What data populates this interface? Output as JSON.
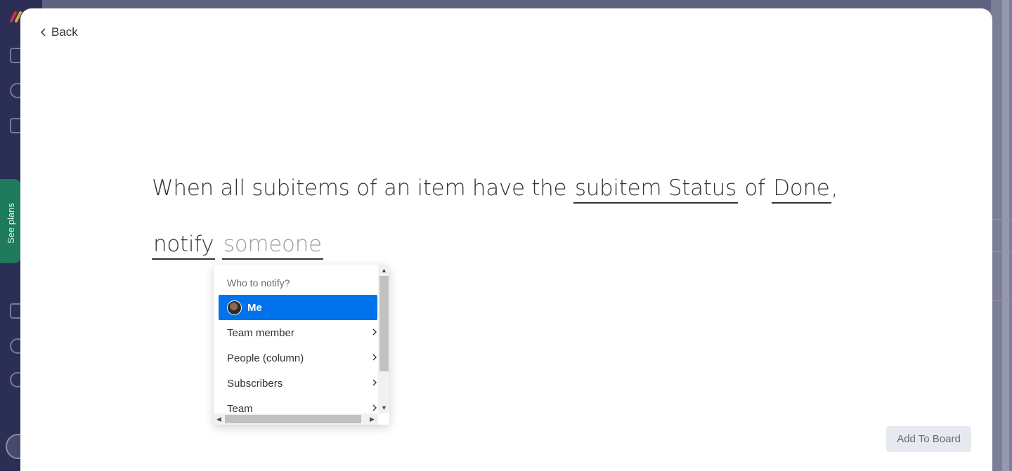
{
  "back": {
    "label": "Back"
  },
  "background": {
    "see_plans_label": "See plans"
  },
  "recipe": {
    "line1": {
      "prefix": "When all subitems of an item have the",
      "column_token": "subitem Status",
      "of_text": "of",
      "value_token": "Done",
      "comma": ","
    },
    "line2": {
      "action_token": "notify",
      "recipient_placeholder": "someone"
    }
  },
  "dropdown": {
    "title": "Who to notify?",
    "items": [
      {
        "label": "Me",
        "selected": true,
        "has_submenu": false,
        "icon": "user-avatar"
      },
      {
        "label": "Team member",
        "selected": false,
        "has_submenu": true,
        "icon": "chevron-right-icon"
      },
      {
        "label": "People (column)",
        "selected": false,
        "has_submenu": true,
        "icon": "chevron-right-icon"
      },
      {
        "label": "Subscribers",
        "selected": false,
        "has_submenu": true,
        "icon": "chevron-right-icon"
      },
      {
        "label": "Team",
        "selected": false,
        "has_submenu": true,
        "icon": "chevron-right-icon"
      }
    ]
  },
  "footer": {
    "add_to_board_label": "Add To Board"
  },
  "colors": {
    "accent": "#0073ea",
    "text": "#323338",
    "placeholder": "#9a9ba4",
    "button_bg": "#e6e9ef",
    "overlay_bg": "#6b6f88"
  }
}
